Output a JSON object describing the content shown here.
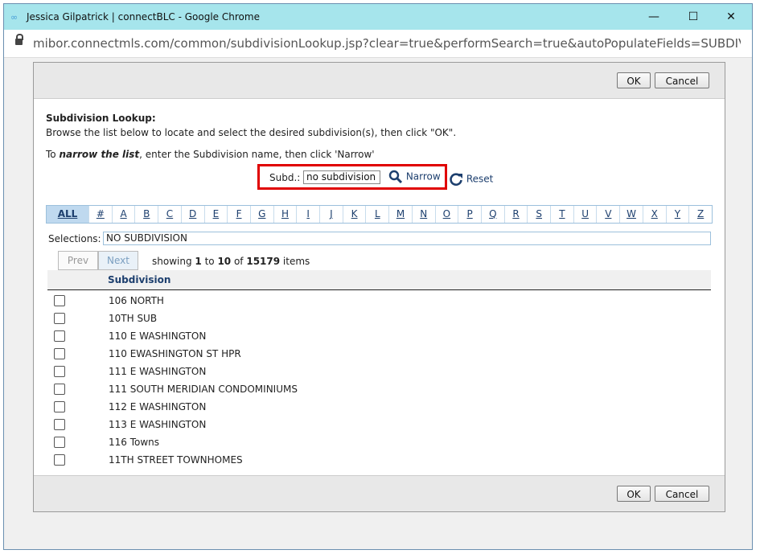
{
  "window": {
    "title": "Jessica Gilpatrick | connectBLC - Google Chrome",
    "minimize": "—",
    "maximize": "☐",
    "close": "✕"
  },
  "browser": {
    "url": "mibor.connectmls.com/common/subdivisionLookup.jsp?clear=true&performSearch=true&autoPopulateFields=SUBDIVISIONNAME&i..."
  },
  "dialog": {
    "ok_label": "OK",
    "cancel_label": "Cancel",
    "heading": "Subdivision Lookup:",
    "instructions": "Browse the list below to locate and select the desired subdivision(s), then click \"OK\".",
    "narrow_intro_prefix": "To ",
    "narrow_intro_em": "narrow the list",
    "narrow_intro_suffix": ", enter the Subdivision name, then click 'Narrow'",
    "subd_label": "Subd.:",
    "subd_value": "no subdivision",
    "narrow_label": "Narrow",
    "reset_label": "Reset",
    "alphabet": [
      "ALL",
      "#",
      "A",
      "B",
      "C",
      "D",
      "E",
      "F",
      "G",
      "H",
      "I",
      "J",
      "K",
      "L",
      "M",
      "N",
      "O",
      "P",
      "Q",
      "R",
      "S",
      "T",
      "U",
      "V",
      "W",
      "X",
      "Y",
      "Z"
    ],
    "selections_label": "Selections:",
    "selections_value": "NO SUBDIVISION",
    "prev_label": "Prev",
    "next_label": "Next",
    "showing_prefix": "showing ",
    "showing_from": "1",
    "showing_to_word": " to ",
    "showing_to": "10",
    "showing_of_word": " of ",
    "showing_total": "15179",
    "showing_suffix": " items",
    "column_header": "Subdivision",
    "rows": [
      "106 NORTH",
      "10TH SUB",
      "110 E WASHINGTON",
      "110 EWASHINGTON ST HPR",
      "111 E WASHINGTON",
      "111 SOUTH MERIDIAN CONDOMINIUMS",
      "112 E WASHINGTON",
      "113 E WASHINGTON",
      "116 Towns",
      "11TH STREET TOWNHOMES"
    ]
  },
  "colors": {
    "titlebar": "#a6e5ec",
    "highlight_border": "#e00000",
    "link": "#1d3f6e"
  }
}
